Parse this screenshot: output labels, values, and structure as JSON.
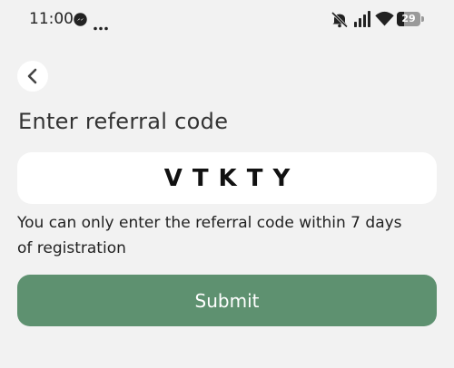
{
  "status_bar": {
    "time": "11:00",
    "battery_level": "29",
    "icons": [
      "messenger-icon",
      "more-dots-icon",
      "mute-icon",
      "signal-icon",
      "wifi-icon",
      "battery-icon"
    ]
  },
  "header": {
    "back_icon": "chevron-left-icon"
  },
  "page": {
    "title": "Enter referral code",
    "code_value": "VTKTY",
    "hint": "You can only enter the referral code within 7 days of registration",
    "submit_label": "Submit"
  },
  "colors": {
    "background": "#f2f2f2",
    "field_background": "#ffffff",
    "submit_button": "#5e9170",
    "submit_text": "#ffffff"
  }
}
